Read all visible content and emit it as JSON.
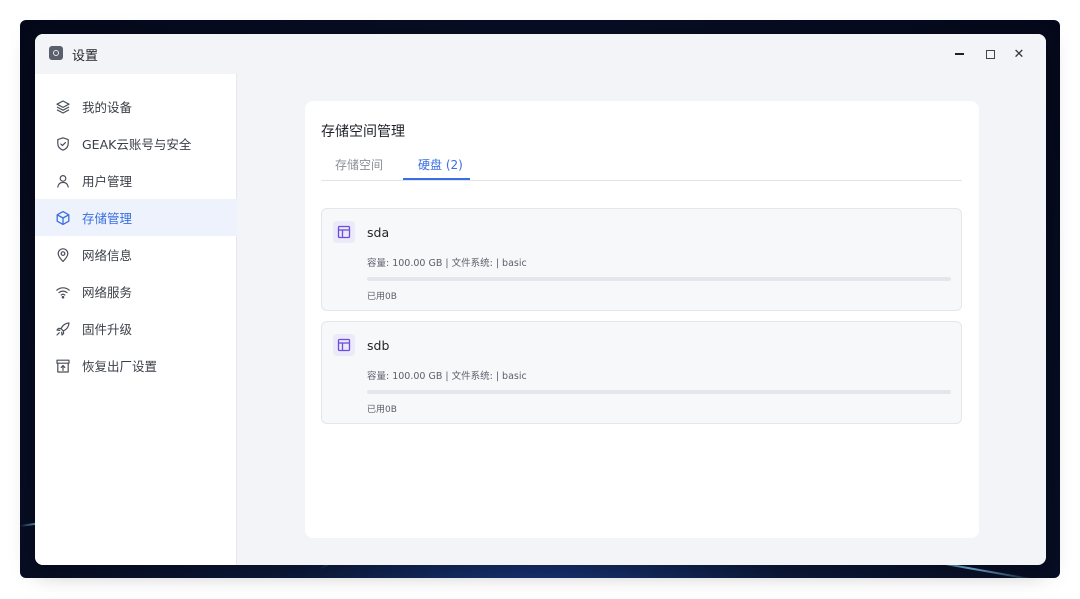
{
  "window": {
    "title": "设置",
    "controls": {
      "minimize_icon": "minimize-icon",
      "maximize_icon": "maximize-icon",
      "close_icon": "close-icon",
      "close_glyph": "✕"
    }
  },
  "sidebar": {
    "items": [
      {
        "id": "my-devices",
        "label": "我的设备",
        "icon": "layers-icon",
        "active": false
      },
      {
        "id": "geak-account",
        "label": "GEAK云账号与安全",
        "icon": "shield-check-icon",
        "active": false
      },
      {
        "id": "user-management",
        "label": "用户管理",
        "icon": "user-icon",
        "active": false
      },
      {
        "id": "storage-management",
        "label": "存储管理",
        "icon": "cube-icon",
        "active": true
      },
      {
        "id": "network-info",
        "label": "网络信息",
        "icon": "location-pin-icon",
        "active": false
      },
      {
        "id": "network-services",
        "label": "网络服务",
        "icon": "wifi-icon",
        "active": false
      },
      {
        "id": "firmware-upgrade",
        "label": "固件升级",
        "icon": "rocket-icon",
        "active": false
      },
      {
        "id": "factory-reset",
        "label": "恢复出厂设置",
        "icon": "factory-reset-icon",
        "active": false
      }
    ]
  },
  "main": {
    "title": "存储空间管理",
    "tabs": [
      {
        "label": "存储空间",
        "active": false
      },
      {
        "label": "硬盘 (2)",
        "active": true
      }
    ],
    "disks": [
      {
        "name": "sda",
        "info": "容量: 100.00 GB | 文件系统: | basic",
        "used_label": "已用0B",
        "used_fraction": 0,
        "icon": "disk-layout-icon"
      },
      {
        "name": "sdb",
        "info": "容量: 100.00 GB | 文件系统: | basic",
        "used_label": "已用0B",
        "used_fraction": 0,
        "icon": "disk-layout-icon"
      }
    ]
  },
  "colors": {
    "accent": "#3a6fe0",
    "active_nav_bg": "#edf2fc",
    "icon_bg": "#ece9fb",
    "icon_fg": "#6a4ee0"
  }
}
